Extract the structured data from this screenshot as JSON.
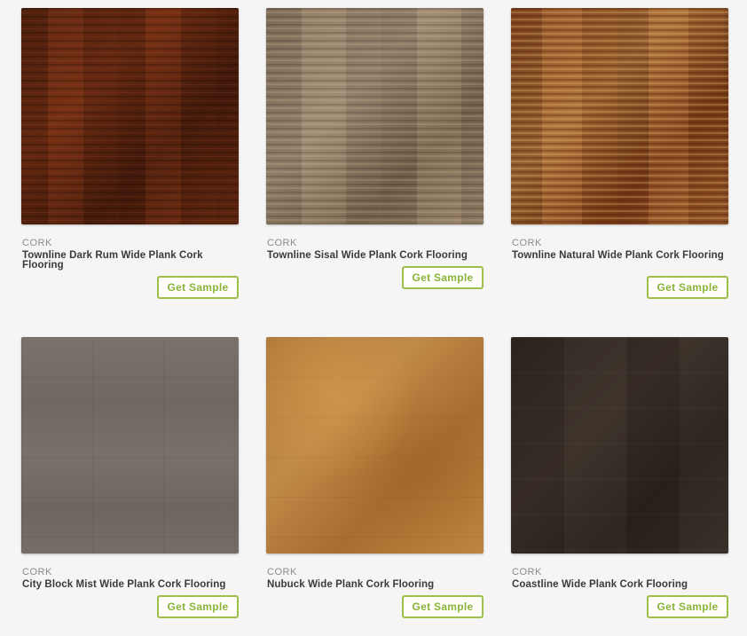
{
  "products": [
    {
      "category": "CORK",
      "title": "Townline Dark Rum Wide Plank Cork Flooring",
      "button_label": "Get Sample",
      "texture": "dark-rum"
    },
    {
      "category": "CORK",
      "title": "Townline Sisal Wide Plank Cork Flooring",
      "button_label": "Get Sample",
      "texture": "sisal"
    },
    {
      "category": "CORK",
      "title": "Townline Natural Wide Plank Cork Flooring",
      "button_label": "Get Sample",
      "texture": "natural"
    },
    {
      "category": "CORK",
      "title": "City Block Mist Wide Plank Cork Flooring",
      "button_label": "Get Sample",
      "texture": "mist"
    },
    {
      "category": "CORK",
      "title": "Nubuck Wide Plank Cork Flooring",
      "button_label": "Get Sample",
      "texture": "nubuck"
    },
    {
      "category": "CORK",
      "title": "Coastline Wide Plank Cork Flooring",
      "button_label": "Get Sample",
      "texture": "coastline"
    }
  ],
  "colors": {
    "background": "#f5f5f5",
    "button_border": "#9cc04a",
    "button_text": "#8ab43a",
    "title_text": "#3a3a3a",
    "category_text": "#8a8a8a"
  }
}
